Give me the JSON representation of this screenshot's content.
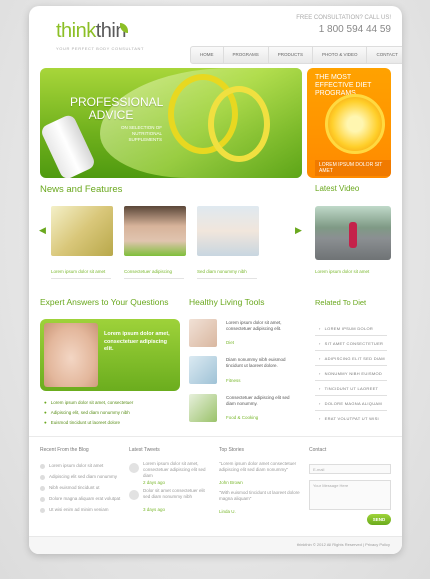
{
  "header": {
    "logo_think": "think",
    "logo_thin": "thin",
    "tagline": "YOUR PERFECT BODY CONSULTANT",
    "consult_label": "FREE CONSULTATION? CALL US!",
    "phone": "1 800 594 44 59"
  },
  "nav": [
    "HOME",
    "PROGRAMS",
    "PRODUCTS",
    "PHOTO & VIDEO",
    "CONTACT"
  ],
  "hero": {
    "title": "PROFESSIONAL ADVICE",
    "subtitle": "ON SELECTION OF NUTRITIONAL SUPPLEMENTS"
  },
  "promo": {
    "title": "THE MOST EFFECTIVE DIET PROGRAMS",
    "link": "LOREM IPSUM DOLOR SIT AMET"
  },
  "news": {
    "title": "News and Features",
    "items": [
      {
        "caption": "Lorem ipsum dolor sit amet"
      },
      {
        "caption": "Consectetuer adipiscing"
      },
      {
        "caption": "Sed diam nonummy nibh"
      }
    ]
  },
  "video": {
    "title": "Latest Video",
    "caption": "Lorem ipsum dolor sit amet"
  },
  "expert": {
    "title": "Expert Answers to Your Questions",
    "card_text": "Lorem ipsum dolor amet, consectetuer adipiscing elit.",
    "bullets": [
      "Lorem ipsum dolor sit amet, consectetuer",
      "Adipiscing elit, sed diam nonummy nibh",
      "Euismod tincidunt ut laoreet dolore"
    ]
  },
  "tools": {
    "title": "Healthy Living Tools",
    "items": [
      {
        "text": "Lorem ipsum dolor sit amet, consectetuer adipiscing elit.",
        "category": "Diet"
      },
      {
        "text": "Diam nonummy nibh euismod tincidunt ut laoreet dolore.",
        "category": "Fitness"
      },
      {
        "text": "Consectetuer adipiscing elit sed diam nonummy.",
        "category": "Food & Cooking"
      }
    ]
  },
  "related": {
    "title": "Related To Diet",
    "items": [
      "LOREM IPSUM DOLOR",
      "SIT AMET CONSECTETUER",
      "ADIPISCING ELIT SED DIAM",
      "NONUMMY NIBH EUISMOD",
      "TINCIDUNT UT LAOREET",
      "DOLORE MAGNA ALIQUAM",
      "ERAT VOLUTPAT UT WISI"
    ]
  },
  "footer": {
    "blog_title": "Recent From the Blog",
    "blog_items": [
      "Lorem ipsum dolor sit amet",
      "Adipiscing elit sed diam nonummy",
      "Nibh euismod tincidunt ut",
      "Dolore magna aliquam erat volutpat",
      "Ut wisi enim ad minim veniam"
    ],
    "tweets_title": "Latest Tweets",
    "tweets": [
      {
        "text": "Lorem ipsum dolor sit amet, consectetuer adipiscing elit sed diam",
        "time": "2 days ago"
      },
      {
        "text": "Dolor sit amet consectetuer elit sed diam nonummy nibh",
        "time": "3 days ago"
      }
    ],
    "stories_title": "Top Stories",
    "stories": [
      {
        "text": "\"Lorem ipsum dolor amet consectetuer adipiscing elit sed diam nonummy\"",
        "author": "John Brown"
      },
      {
        "text": "\"With euismod tincidunt ut laoreet dolore magna aliquam\"",
        "author": "Linda U."
      }
    ],
    "contact_title": "Contact",
    "email_placeholder": "E-mail",
    "message_placeholder": "Your Message Here",
    "send_label": "SEND",
    "copyright": "thinkthin © 2012 All Rights Reserved  |  Privacy Policy"
  }
}
